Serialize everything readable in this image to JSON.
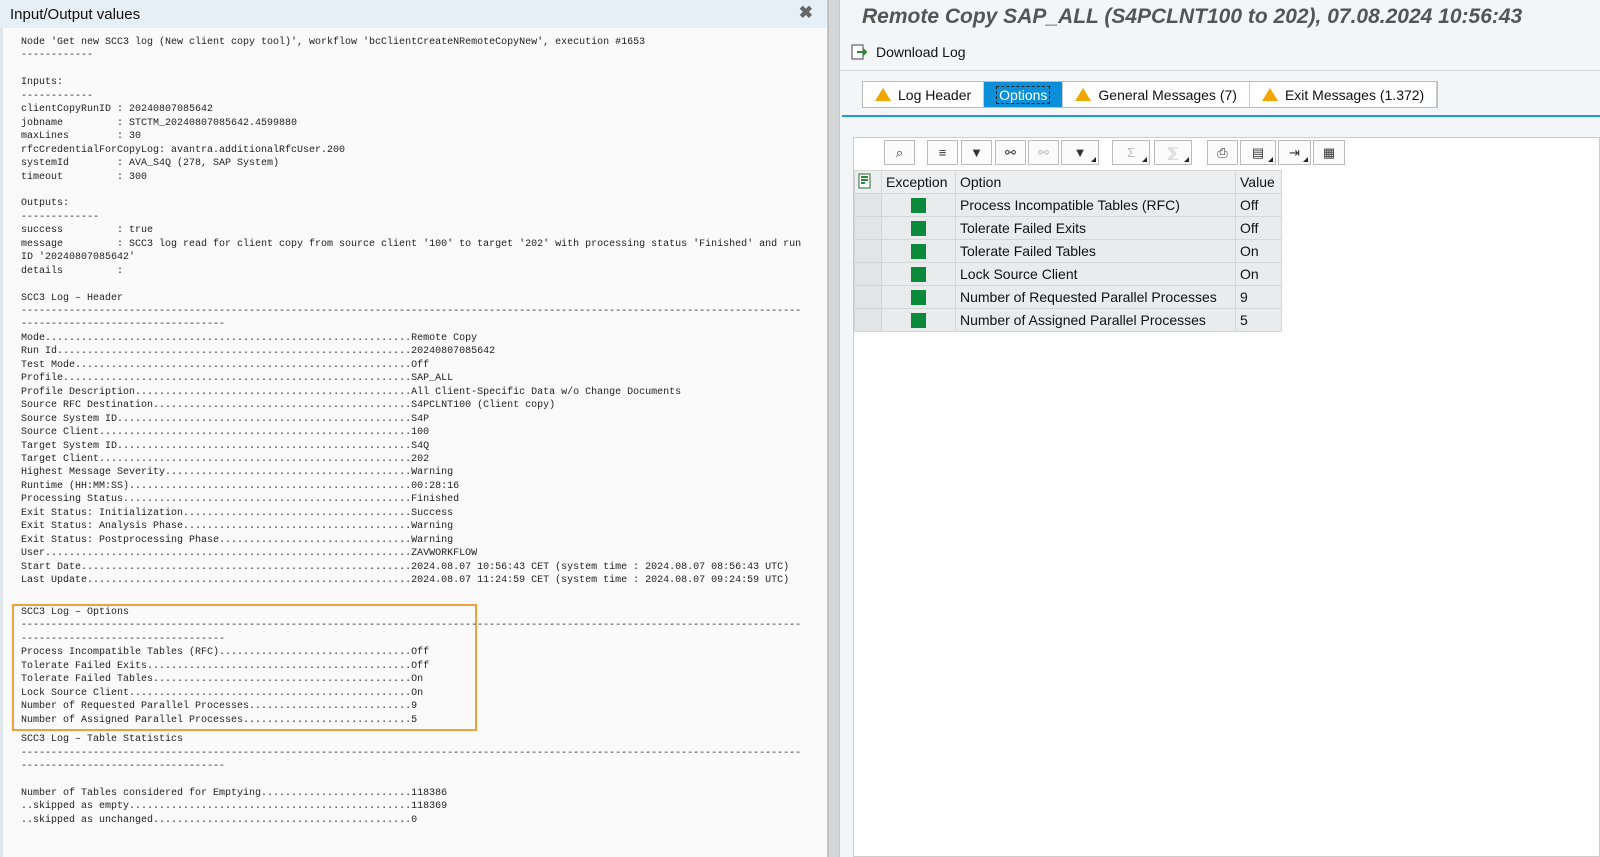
{
  "left": {
    "title": "Input/Output values",
    "close_icon": "close-icon",
    "before": [
      {
        "t": "Node 'Get new SCC3 log (New client copy tool)', workflow 'bcClientCreateNRemoteCopyNew', execution #1653"
      },
      {
        "t": "------------"
      },
      {
        "t": ""
      },
      {
        "t": "Inputs:"
      },
      {
        "t": "------------"
      },
      {
        "t": "clientCopyRunID : 20240807085642"
      },
      {
        "t": "jobname         : STCTM_20240807085642.4599880"
      },
      {
        "t": "maxLines        : 30"
      },
      {
        "t": "rfcCredentialForCopyLog: avantra.additionalRfcUser.200"
      },
      {
        "t": "systemId        : AVA_S4Q (278, SAP System)"
      },
      {
        "t": "timeout         : 300"
      },
      {
        "t": ""
      },
      {
        "t": "Outputs:"
      },
      {
        "t": "-------------"
      },
      {
        "t": "success         : true"
      },
      {
        "t": "message         : SCC3 log read for client copy from source client '100' to target '202' with processing status 'Finished' and run ID '20240807085642'"
      },
      {
        "t": "details         :"
      },
      {
        "t": ""
      },
      {
        "t": "SCC3 Log – Header"
      },
      {
        "t": "--------------------------------------------------------------------------------------------------------------------------------------------------------------------"
      },
      {
        "k": "Mode",
        "v": "Remote Copy"
      },
      {
        "k": "Run Id",
        "v": "20240807085642"
      },
      {
        "k": "Test Mode",
        "v": "Off"
      },
      {
        "k": "Profile",
        "v": "SAP_ALL"
      },
      {
        "k": "Profile Description",
        "v": "All Client-Specific Data w/o Change Documents"
      },
      {
        "k": "Source RFC Destination",
        "v": "S4PCLNT100 (Client copy)"
      },
      {
        "k": "Source System ID",
        "v": "S4P"
      },
      {
        "k": "Source Client",
        "v": "100"
      },
      {
        "k": "Target System ID",
        "v": "S4Q"
      },
      {
        "k": "Target Client",
        "v": "202"
      },
      {
        "k": "Highest Message Severity",
        "v": "Warning"
      },
      {
        "k": "Runtime (HH:MM:SS)",
        "v": "00:28:16"
      },
      {
        "k": "Processing Status",
        "v": "Finished"
      },
      {
        "k": "Exit Status: Initialization",
        "v": "Success"
      },
      {
        "k": "Exit Status: Analysis Phase",
        "v": "Warning"
      },
      {
        "k": "Exit Status: Postprocessing Phase",
        "v": "Warning"
      },
      {
        "k": "User",
        "v": "ZAVWORKFLOW"
      },
      {
        "k": "Start Date",
        "v": "2024.08.07 10:56:43 CET (system time : 2024.08.07 08:56:43 UTC)"
      },
      {
        "k": "Last Update",
        "v": "2024.08.07 11:24:59 CET (system time : 2024.08.07 09:24:59 UTC)"
      }
    ],
    "options": [
      {
        "t": "SCC3 Log – Options"
      },
      {
        "t": "--------------------------------------------------------------------------------------------------------------------------------------------------------------------"
      },
      {
        "k": "Process Incompatible Tables (RFC)",
        "v": "Off"
      },
      {
        "k": "Tolerate Failed Exits",
        "v": "Off"
      },
      {
        "k": "Tolerate Failed Tables",
        "v": "On"
      },
      {
        "k": "Lock Source Client",
        "v": "On"
      },
      {
        "k": "Number of Requested Parallel Processes",
        "v": "9"
      },
      {
        "k": "Number of Assigned Parallel Processes",
        "v": "5"
      }
    ],
    "after": [
      {
        "t": "SCC3 Log – Table Statistics"
      },
      {
        "t": "--------------------------------------------------------------------------------------------------------------------------------------------------------------------"
      },
      {
        "t": ""
      },
      {
        "k": "Number of Tables considered for Emptying",
        "v": "118386"
      },
      {
        "k": "..skipped as empty",
        "v": "118369"
      },
      {
        "k": "..skipped as unchanged",
        "v": "0"
      }
    ]
  },
  "right": {
    "title": "Remote Copy SAP_ALL (S4PCLNT100 to 202), 07.08.2024 10:56:43",
    "download_label": "Download Log",
    "tabs": [
      {
        "label": "Log Header",
        "warning": true
      },
      {
        "label": "Options",
        "warning": false,
        "active": true
      },
      {
        "label": "General Messages (7)",
        "warning": true
      },
      {
        "label": "Exit Messages (1.372)",
        "warning": true
      }
    ],
    "toolbar": [
      "details-icon",
      "sort-ascending-icon",
      "sort-descending-icon",
      "find-icon",
      "find-next-icon",
      "filter-icon",
      "sum-icon",
      "subtotal-icon",
      "print-icon",
      "views-icon",
      "export-icon",
      "layout-icon"
    ],
    "table": {
      "headers": [
        "Exception",
        "Option",
        "Value"
      ],
      "rows": [
        {
          "option": "Process Incompatible Tables (RFC)",
          "value": "Off"
        },
        {
          "option": "Tolerate Failed Exits",
          "value": "Off"
        },
        {
          "option": "Tolerate Failed Tables",
          "value": "On"
        },
        {
          "option": "Lock Source Client",
          "value": "On"
        },
        {
          "option": "Number of Requested Parallel Processes",
          "value": "9"
        },
        {
          "option": "Number of Assigned Parallel Processes",
          "value": "5"
        }
      ],
      "exception_color": "#0a8a3a"
    }
  },
  "colors": {
    "highlight_box": "#f0a040",
    "active_tab": "#0a8fd8",
    "warning": "#f0a800"
  }
}
